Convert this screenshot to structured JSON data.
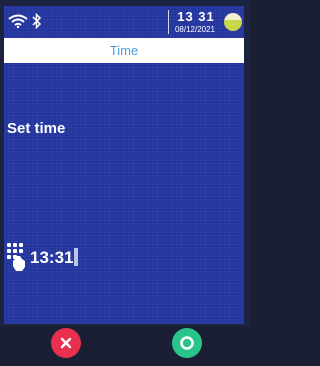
{
  "status": {
    "time": "13 31",
    "date": "08/12/2021",
    "icons": [
      "wifi-icon",
      "bluetooth-icon",
      "battery-icon"
    ]
  },
  "header": {
    "title": "Time"
  },
  "main": {
    "label": "Set time",
    "input_value": "13:31",
    "input_icon": "keypad-icon"
  },
  "footer": {
    "cancel_icon": "close-icon",
    "confirm_icon": "circle-ok-icon"
  },
  "colors": {
    "screen_bg": "#2436a0",
    "title_text": "#4aa0d6",
    "cancel": "#e8304e",
    "confirm": "#28c48a"
  }
}
